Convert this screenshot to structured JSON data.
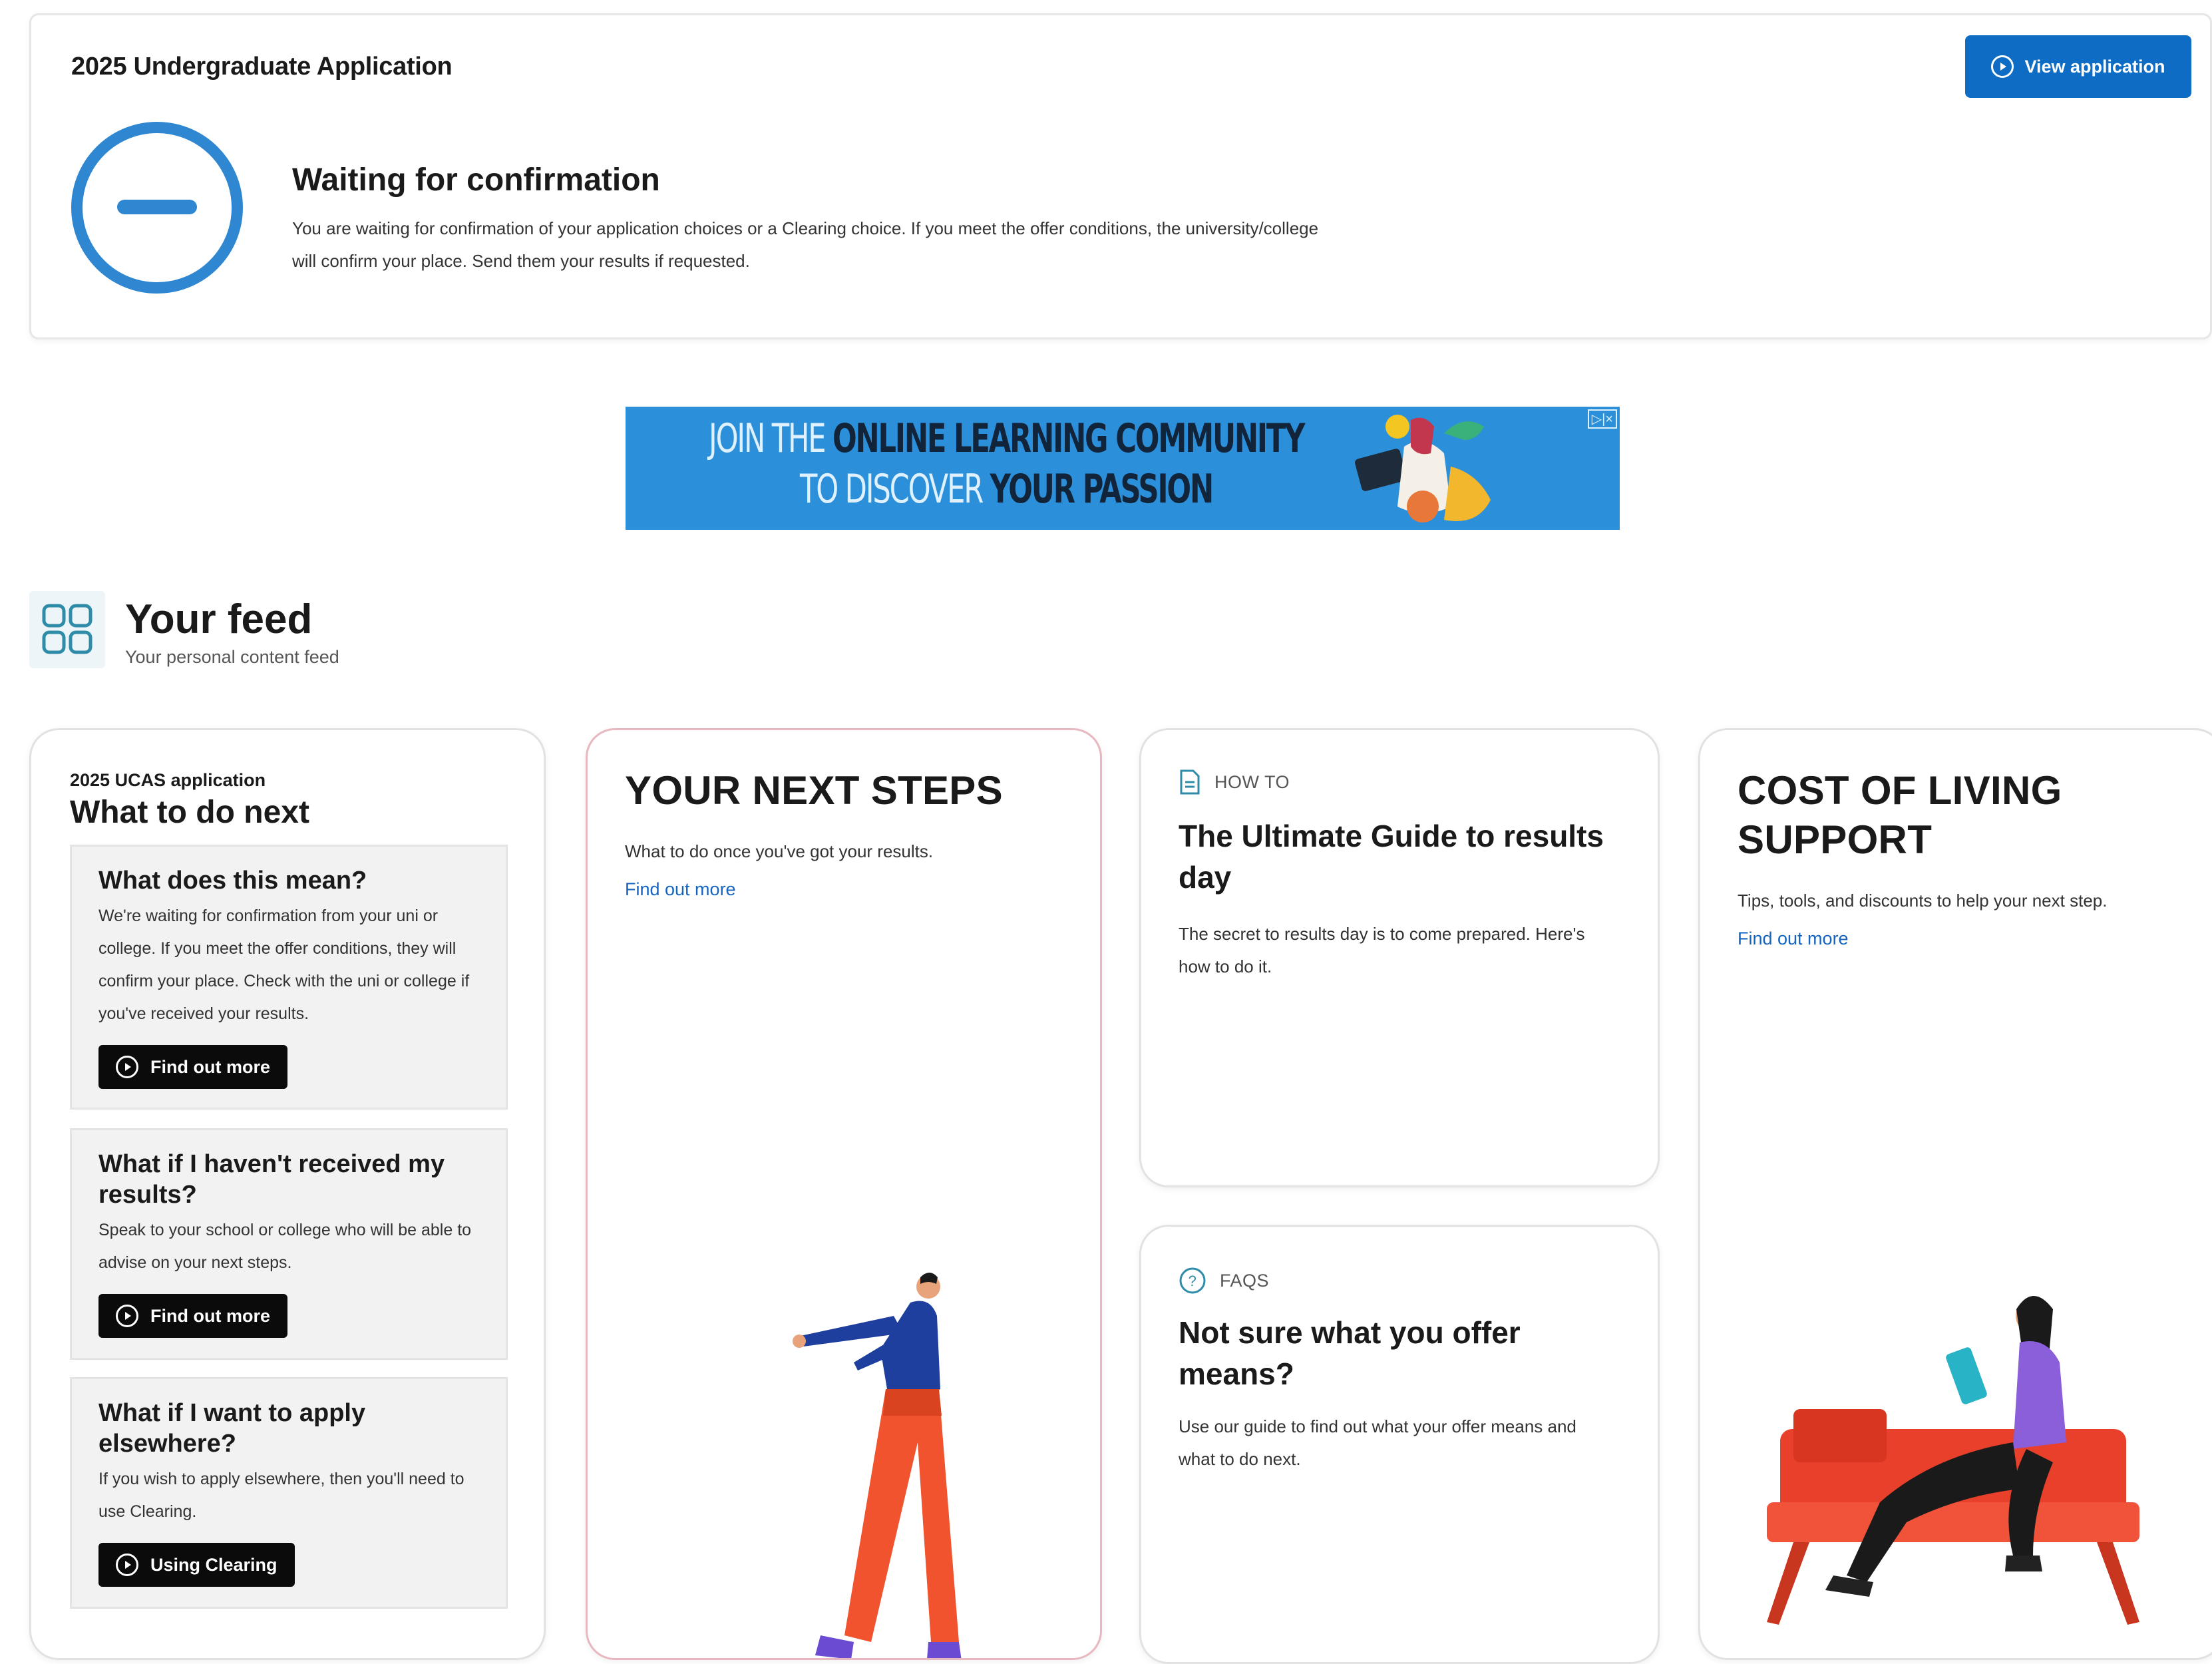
{
  "application": {
    "title": "2025 Undergraduate Application",
    "view_button": "View application",
    "status_heading": "Waiting for confirmation",
    "status_text": "You are waiting for confirmation of your application choices or a Clearing choice. If you meet the offer conditions, the university/college will confirm your place. Send them your results if requested."
  },
  "banner": {
    "line1_light": "JOIN THE ",
    "line1_dark": "ONLINE LEARNING COMMUNITY",
    "line2_light": "TO DISCOVER ",
    "line2_dark": "YOUR PASSION",
    "ad_badge": "▷|×"
  },
  "feed": {
    "title": "Your feed",
    "subtitle": "Your personal content feed"
  },
  "what_to_do": {
    "pretitle": "2025 UCAS application",
    "title": "What to do next",
    "items": [
      {
        "title": "What does this mean?",
        "text": "We're waiting for confirmation from your uni or college. If you meet the offer conditions, they will confirm your place. Check with the uni or college if you've received your results.",
        "button": "Find out more"
      },
      {
        "title": "What if I haven't received my results?",
        "text": "Speak to your school or college who will be able to advise on your next steps.",
        "button": "Find out more"
      },
      {
        "title": "What if I want to apply elsewhere?",
        "text": "If you wish to apply elsewhere, then you'll need to use Clearing.",
        "button": "Using Clearing"
      }
    ]
  },
  "next_steps": {
    "title": "YOUR NEXT STEPS",
    "text": "What to do once you've got your results.",
    "link": "Find out more"
  },
  "results_guide": {
    "tag": "HOW TO",
    "title": "The Ultimate Guide to results day",
    "text": "The secret to results day is to come prepared. Here's how to do it."
  },
  "faqs": {
    "tag": "FAQS",
    "title": "Not sure what you offer means?",
    "text": "Use our guide to find out what your offer means and what to do next."
  },
  "cost_of_living": {
    "title": "COST OF LIVING SUPPORT",
    "text": "Tips, tools, and discounts to help your next step.",
    "link": "Find out more"
  },
  "colors": {
    "primary_button": "#0f6cc4",
    "status_icon": "#2e87d0",
    "banner_bg": "#2c8fd9",
    "link": "#1565c0"
  },
  "icons": {
    "view_button_icon": "play-circle-icon",
    "status_icon": "minus-circle-icon",
    "feed_icon": "grid-icon",
    "how_to_icon": "document-icon",
    "faq_icon": "question-circle-icon"
  }
}
